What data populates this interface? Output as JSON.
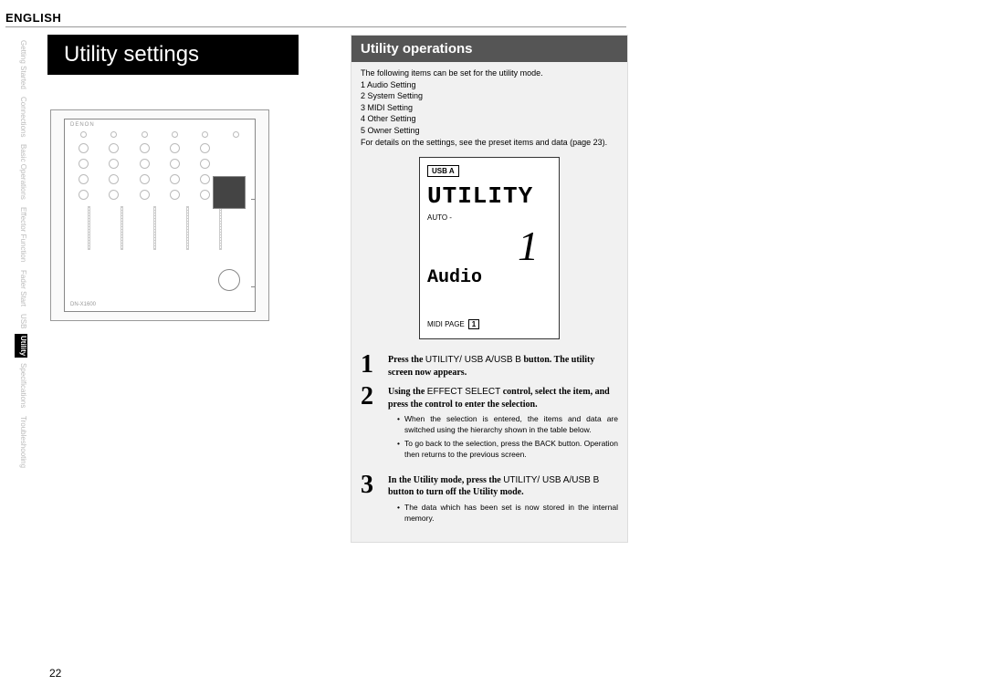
{
  "language": "ENGLISH",
  "sideTabs": {
    "items": [
      {
        "label": "Getting Started",
        "active": false
      },
      {
        "label": "Connections",
        "active": false
      },
      {
        "label": "Basic Operations",
        "active": false
      },
      {
        "label": "Effector Function",
        "active": false
      },
      {
        "label": "Fader Start",
        "active": false
      },
      {
        "label": "USB",
        "active": false
      },
      {
        "label": "Utility",
        "active": true
      },
      {
        "label": "Specifications",
        "active": false
      },
      {
        "label": "Troubleshooting",
        "active": false
      }
    ]
  },
  "mainTitle": "Utility settings",
  "diagram": {
    "brand": "DENON",
    "model": "DN-X1600"
  },
  "section": {
    "title": "Utility operations",
    "intro": "The following items can be set for the utility mode.",
    "items": [
      "1 Audio Setting",
      "2 System Setting",
      "3 MIDI Setting",
      "4 Other Setting",
      "5 Owner Setting"
    ],
    "detailNote": "For details on the settings, see the preset items and data (page 23)."
  },
  "lcd": {
    "badge": "USB A",
    "title": "UTILITY",
    "auto": "AUTO -",
    "bigNum": "1",
    "sub": "Audio",
    "footer": "MIDI PAGE",
    "page": "1"
  },
  "steps": {
    "s1": {
      "num": "1",
      "pre": "Press the ",
      "btn": "UTILITY/ USB A/USB B",
      "post": " button. The utility screen now appears."
    },
    "s2": {
      "num": "2",
      "pre": "Using the ",
      "btn": "EFFECT SELECT",
      "post": " control, select the item, and press the control to enter the selection."
    },
    "s2bullets": [
      "When the selection is entered, the items and data are switched using the hierarchy shown in the table below.",
      "To go back to the selection, press the BACK button. Operation then returns to the previous screen."
    ],
    "s3": {
      "num": "3",
      "pre": "In the Utility mode, press the ",
      "btn": "UTILITY/ USB A/USB B",
      "post": " button to turn off the Utility mode."
    },
    "s3bullets": [
      "The data which has been set is now stored in the internal memory."
    ]
  },
  "pageNumber": "22"
}
